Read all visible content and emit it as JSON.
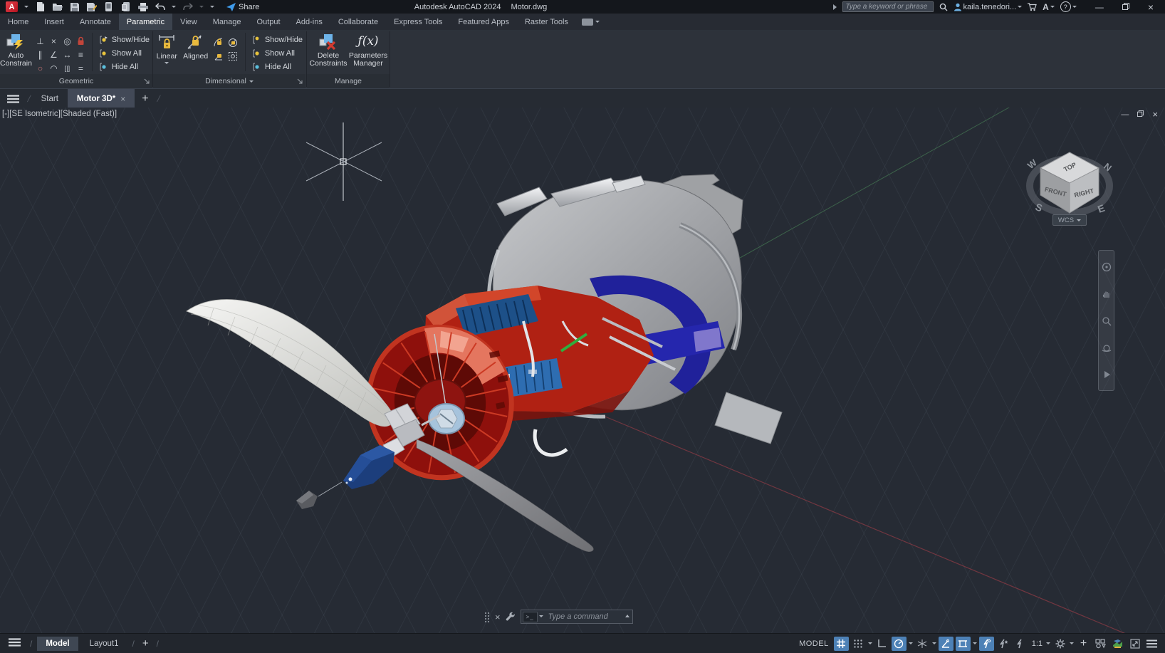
{
  "title_bar": {
    "app_title": "Autodesk AutoCAD 2024",
    "doc_title": "Motor.dwg",
    "app_badge_letter": "A",
    "share_label": "Share",
    "search_placeholder": "Type a keyword or phrase",
    "user_name": "kaila.tenedori...",
    "autodesk_account_letter": "A",
    "help_glyph": "?"
  },
  "glyphs": {
    "close": "×",
    "minimize": "—",
    "plus": "+",
    "slash": "/"
  },
  "ribbon_tabs": [
    {
      "label": "Home"
    },
    {
      "label": "Insert"
    },
    {
      "label": "Annotate"
    },
    {
      "label": "Parametric"
    },
    {
      "label": "View"
    },
    {
      "label": "Manage"
    },
    {
      "label": "Output"
    },
    {
      "label": "Add-ins"
    },
    {
      "label": "Collaborate"
    },
    {
      "label": "Express Tools"
    },
    {
      "label": "Featured Apps"
    },
    {
      "label": "Raster Tools"
    }
  ],
  "ribbon": {
    "geometric": {
      "title": "Geometric",
      "auto_constrain": "Auto Constrain",
      "show_hide": "Show/Hide",
      "show_all": "Show All",
      "hide_all": "Hide All"
    },
    "dimensional": {
      "title": "Dimensional",
      "linear": "Linear",
      "aligned": "Aligned",
      "show_hide": "Show/Hide",
      "show_all": "Show All",
      "hide_all": "Hide All"
    },
    "manage": {
      "title": "Manage",
      "delete_constraints": "Delete Constraints",
      "parameters_manager": "Parameters Manager",
      "fx_glyph": "ƒ(x)"
    }
  },
  "icons": {
    "constraint_glyphs": {
      "perpendicular": "⊥",
      "tangent": "×",
      "concentric": "◎",
      "parallel": "∥",
      "smooth": "∠",
      "horizontal": "↔",
      "collinear": "≡",
      "circle": "○",
      "arc": "◠",
      "symmetric": "[|]",
      "equal": "="
    }
  },
  "file_tabs": {
    "start": "Start",
    "active_doc": "Motor 3D*"
  },
  "viewport": {
    "label": "[-][SE Isometric][Shaded (Fast)]",
    "viewcube": {
      "top": "TOP",
      "front": "FRONT",
      "right": "RIGHT",
      "north": "N",
      "south": "S",
      "east": "E",
      "west": "W",
      "wcs": "WCS"
    },
    "command_placeholder": "Type a command"
  },
  "status_bar": {
    "model_tab": "Model",
    "layout_tab": "Layout1",
    "model_space": "MODEL",
    "annotation_scale": "1:1"
  },
  "colors": {
    "highlight_blue": "#4d81b6",
    "viewport_background": "#262b34",
    "axis_x_red": "#8a3a44",
    "axis_y_green": "#4e8f5c",
    "model_red": "#b02113",
    "model_navy": "#20219a",
    "model_blue": "#2e6db1",
    "model_gray": "#a9abae",
    "spinner_navy": "#1c3e7c",
    "gold_lock": "#e8b93e",
    "share_blue": "#3f9bea"
  }
}
